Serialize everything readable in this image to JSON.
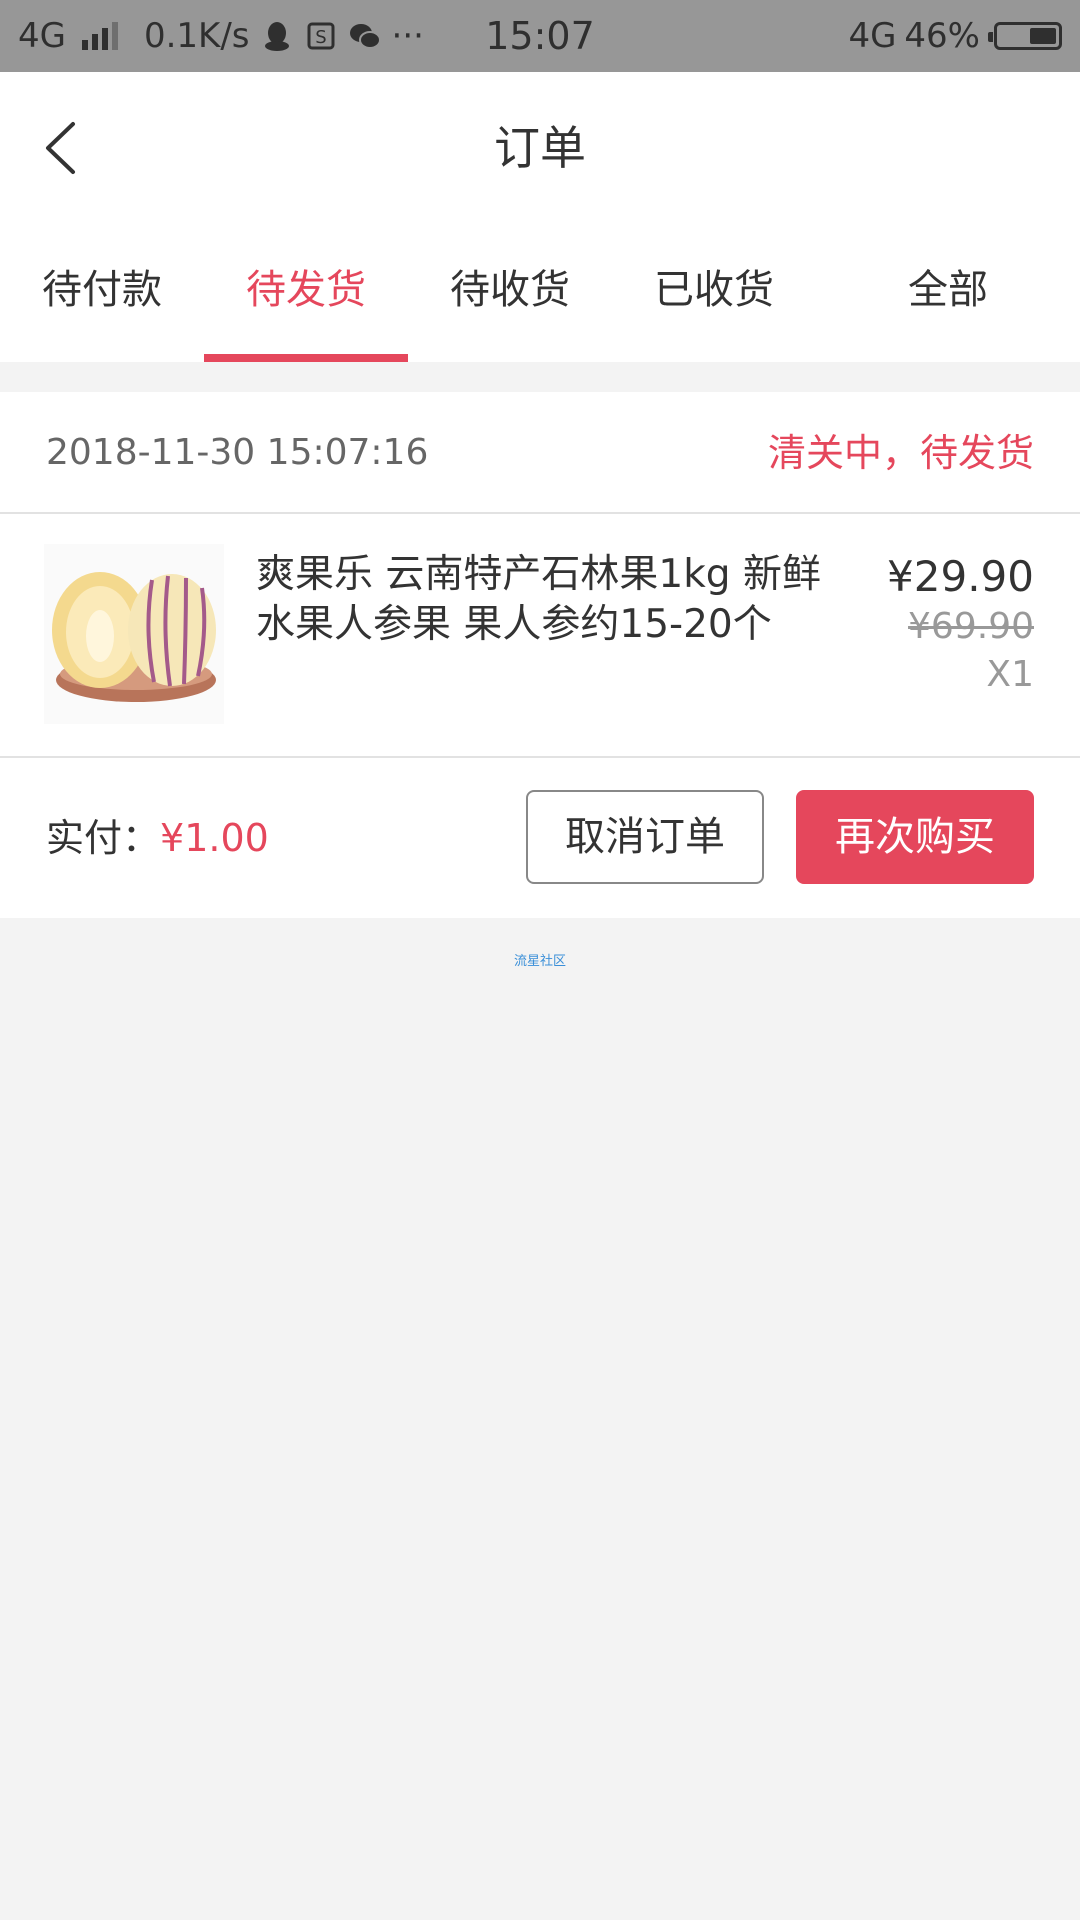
{
  "status_bar": {
    "network": "4G",
    "speed": "0.1K/s",
    "icons": [
      "qq-icon",
      "s-app-icon",
      "wechat-icon",
      "more-dots-icon"
    ],
    "more": "···",
    "time": "15:07",
    "network_right": "4G",
    "battery": "46%",
    "battery_level": 0.46
  },
  "header": {
    "back_icon": "chevron-left-icon",
    "title": "订单"
  },
  "tabs": [
    {
      "label": "待付款",
      "active": false
    },
    {
      "label": "待发货",
      "active": true
    },
    {
      "label": "待收货",
      "active": false
    },
    {
      "label": "已收货",
      "active": false
    },
    {
      "label": "全部",
      "active": false
    }
  ],
  "order": {
    "time": "2018-11-30 15:07:16",
    "status": "清关中，待发货",
    "item": {
      "name": "爽果乐 云南特产石林果1kg 新鲜水果人参果 果人参约15-20个",
      "price": "¥29.90",
      "original_price": "¥69.90",
      "quantity": "X1"
    },
    "paid_label": "实付：",
    "paid_amount": "¥1.00",
    "cancel_label": "取消订单",
    "rebuy_label": "再次购买"
  },
  "watermark": "流星社区",
  "colors": {
    "accent": "#e5475c",
    "status_bar": "#979797",
    "background": "#f3f3f3"
  }
}
